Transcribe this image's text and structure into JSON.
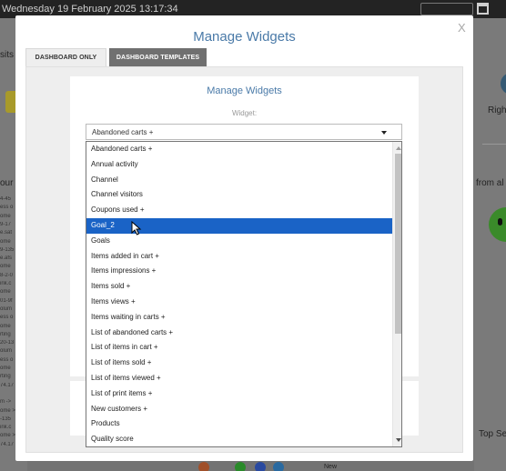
{
  "background": {
    "datetime": "Wednesday 19 February 2025 13:17:34",
    "left_snippets": [
      "sits",
      "our"
    ],
    "right_snippets": [
      "Righ",
      "from al",
      "Top Se"
    ],
    "bottom_new_label": "New",
    "left_log_lines": [
      "4-45",
      "ess o",
      "ome",
      "9-17",
      "e.sat",
      "ome",
      "9-135",
      "e.afs",
      "ome",
      "8-2-0",
      "ink.c",
      "ome",
      "01-9f",
      "olum",
      "ess o",
      "ome",
      "rting",
      "20-13",
      "olum",
      "ess o",
      "ome",
      "rting",
      "74.17",
      "",
      "m ->",
      "ome >",
      "-135",
      "ink.c",
      "ome >",
      "74.17"
    ]
  },
  "modal": {
    "title": "Manage Widgets",
    "close_label": "X",
    "tabs": [
      {
        "label": "DASHBOARD ONLY",
        "active": true
      },
      {
        "label": "DASHBOARD TEMPLATES",
        "active": false
      }
    ],
    "inner_title": "Manage Widgets",
    "widget_label": "Widget:",
    "widget_select": {
      "selected_value": "Abandoned carts +",
      "options": [
        "Abandoned carts +",
        "Annual activity",
        "Channel",
        "Channel visitors",
        "Coupons used +",
        "Goal_2",
        "Goals",
        "Items added in cart +",
        "Items impressions +",
        "Items sold +",
        "Items views +",
        "Items waiting in carts +",
        "List of abandoned carts +",
        "List of items in cart +",
        "List of items sold +",
        "List of items viewed +",
        "List of print items +",
        "New customers +",
        "Products",
        "Quality score"
      ],
      "highlighted_index": 5
    }
  },
  "colors": {
    "accent_blue": "#4a7aa8",
    "highlight": "#1a63c6",
    "inactive_tab": "#707070"
  }
}
